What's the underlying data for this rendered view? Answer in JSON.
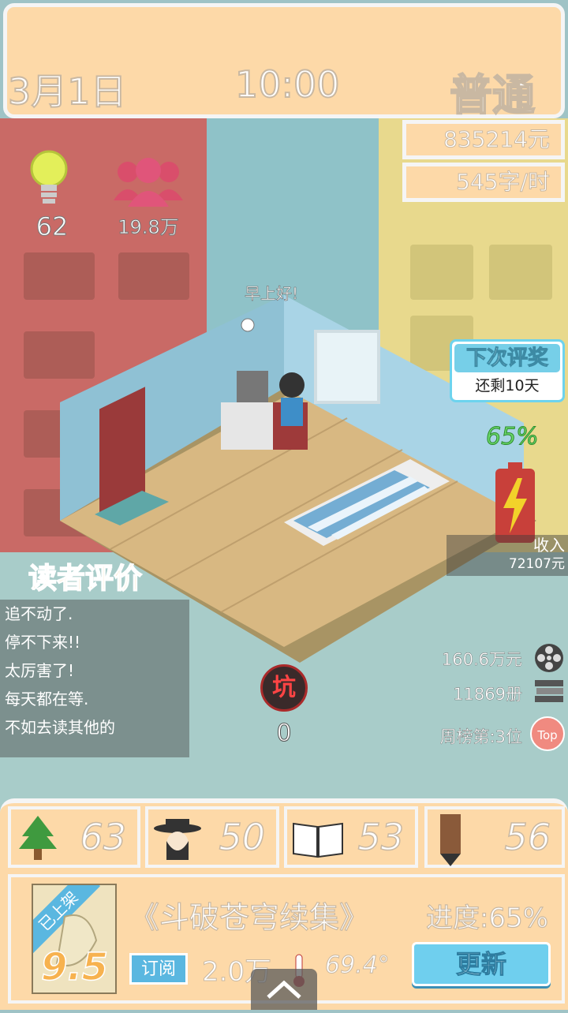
{
  "header": {
    "date": "3月1日",
    "time": "10:00",
    "mode": "普通"
  },
  "stats": {
    "money": "835214元",
    "speed": "545字/时"
  },
  "indicators": {
    "inspiration": "62",
    "fans": "19.8万"
  },
  "room": {
    "greeting": "早上好!"
  },
  "award": {
    "title": "下次评奖",
    "remaining": "还剩10天"
  },
  "energy": {
    "percent": "65%",
    "level": 0.65
  },
  "income": {
    "label": "收入",
    "value": "72107元"
  },
  "reviews": {
    "title": "读者评价",
    "items": [
      "追不动了.",
      "停不下来!!",
      "太厉害了!",
      "每天都在等.",
      "不如去读其他的"
    ]
  },
  "pit": {
    "label": "坑",
    "value": "0"
  },
  "right_stats": {
    "box_office": "160.6万元",
    "copies": "11869册",
    "rank": "周榜第:3位",
    "rank_badge": "Top"
  },
  "attributes": [
    {
      "icon": "tree-icon",
      "value": "63"
    },
    {
      "icon": "character-icon",
      "value": "50"
    },
    {
      "icon": "book-icon",
      "value": "53"
    },
    {
      "icon": "pencil-icon",
      "value": "56"
    }
  ],
  "book": {
    "status": "已上架",
    "score": "9.5",
    "title": "《斗破苍穹续集》",
    "progress": "进度:65%",
    "subscribe_label": "订阅",
    "subscribers": "2.0万",
    "temperature": "69.4°",
    "update_label": "更新"
  },
  "colors": {
    "panel": "#fdd9a8",
    "accent": "#6fcfee",
    "review_title": "#f7b24f"
  }
}
